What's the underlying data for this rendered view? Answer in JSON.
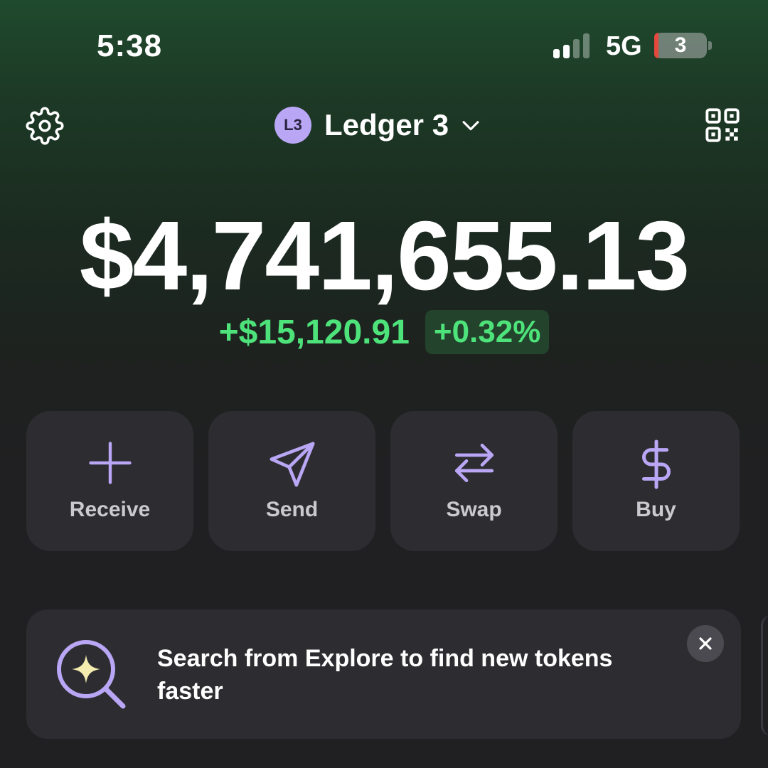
{
  "status_bar": {
    "time": "5:38",
    "network": "5G",
    "battery": "3",
    "icons": [
      "cellular-signal-icon",
      "battery-icon"
    ]
  },
  "header": {
    "account_avatar": "L3",
    "account_name": "Ledger 3",
    "icons": [
      "gear-icon",
      "chevron-down-icon",
      "qr-code-icon"
    ]
  },
  "portfolio": {
    "balance": "$4,741,655.13",
    "change_amount": "+$15,120.91",
    "change_percent": "+0.32%"
  },
  "actions": [
    {
      "label": "Receive",
      "icon": "plus-icon"
    },
    {
      "label": "Send",
      "icon": "paper-plane-icon"
    },
    {
      "label": "Swap",
      "icon": "swap-arrows-icon"
    },
    {
      "label": "Buy",
      "icon": "dollar-icon"
    }
  ],
  "banner": {
    "text": "Search from Explore to find new tokens faster",
    "icon": "search-sparkle-icon",
    "close_icon": "close-icon"
  },
  "colors": {
    "accent": "#b9a6f5",
    "positive": "#4ee27a",
    "card": "#2d2d31"
  }
}
